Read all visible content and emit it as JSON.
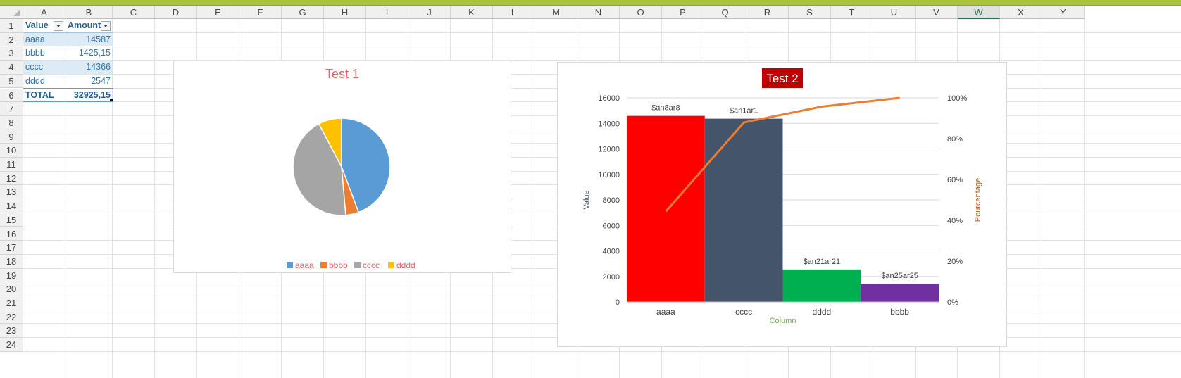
{
  "columns": [
    "A",
    "B",
    "C",
    "D",
    "E",
    "F",
    "G",
    "H",
    "I",
    "J",
    "K",
    "L",
    "M",
    "N",
    "O",
    "P",
    "Q",
    "R",
    "S",
    "T",
    "U",
    "V",
    "W",
    "X",
    "Y"
  ],
  "selected_column": "W",
  "rows": [
    "1",
    "2",
    "3",
    "4",
    "5",
    "6",
    "7",
    "8",
    "9",
    "10",
    "11",
    "12",
    "13",
    "14",
    "15",
    "16",
    "17",
    "18",
    "19",
    "20",
    "21",
    "22",
    "23",
    "24"
  ],
  "table": {
    "headers": [
      "Value",
      "Amount"
    ],
    "rows": [
      {
        "value": "aaaa",
        "amount": "14587"
      },
      {
        "value": "bbbb",
        "amount": "1425,15"
      },
      {
        "value": "cccc",
        "amount": "14366"
      },
      {
        "value": "dddd",
        "amount": "2547"
      }
    ],
    "total_label": "TOTAL",
    "total_amount": "32925,15"
  },
  "colors": {
    "accent_bar": "#a9c43c",
    "table_text": "#2e75b6",
    "chart1_title": "#e06666"
  },
  "chart_data": [
    {
      "type": "pie",
      "title": "Test 1",
      "categories": [
        "aaaa",
        "bbbb",
        "cccc",
        "dddd"
      ],
      "values": [
        14587,
        1425.15,
        14366,
        2547
      ],
      "colors": [
        "#5b9bd5",
        "#ed7d31",
        "#a5a5a5",
        "#ffc000"
      ],
      "legend_position": "bottom"
    },
    {
      "type": "bar",
      "title": "Test 2",
      "categories": [
        "aaaa",
        "cccc",
        "dddd",
        "bbbb"
      ],
      "values": [
        14587,
        14366,
        2547,
        1425.15
      ],
      "bar_colors": [
        "#ff0000",
        "#44546a",
        "#00b050",
        "#7030a0"
      ],
      "data_labels": [
        "$an8ar8",
        "$an1ar1",
        "$an21ar21",
        "$an25ar25"
      ],
      "line": {
        "x": [
          "aaaa",
          "cccc",
          "dddd",
          "bbbb"
        ],
        "values": [
          44.3,
          87.9,
          95.7,
          100
        ],
        "color": "#ed7d31"
      },
      "xlabel": "Column",
      "ylabel": "Value",
      "y2label": "Pourcentage",
      "ylim": [
        0,
        16000
      ],
      "y_ticks": [
        "0",
        "2000",
        "4000",
        "6000",
        "8000",
        "10000",
        "12000",
        "14000",
        "16000"
      ],
      "y2lim": [
        0,
        100
      ],
      "y2_ticks": [
        "0%",
        "20%",
        "40%",
        "60%",
        "80%",
        "100%"
      ],
      "grid": true
    }
  ]
}
